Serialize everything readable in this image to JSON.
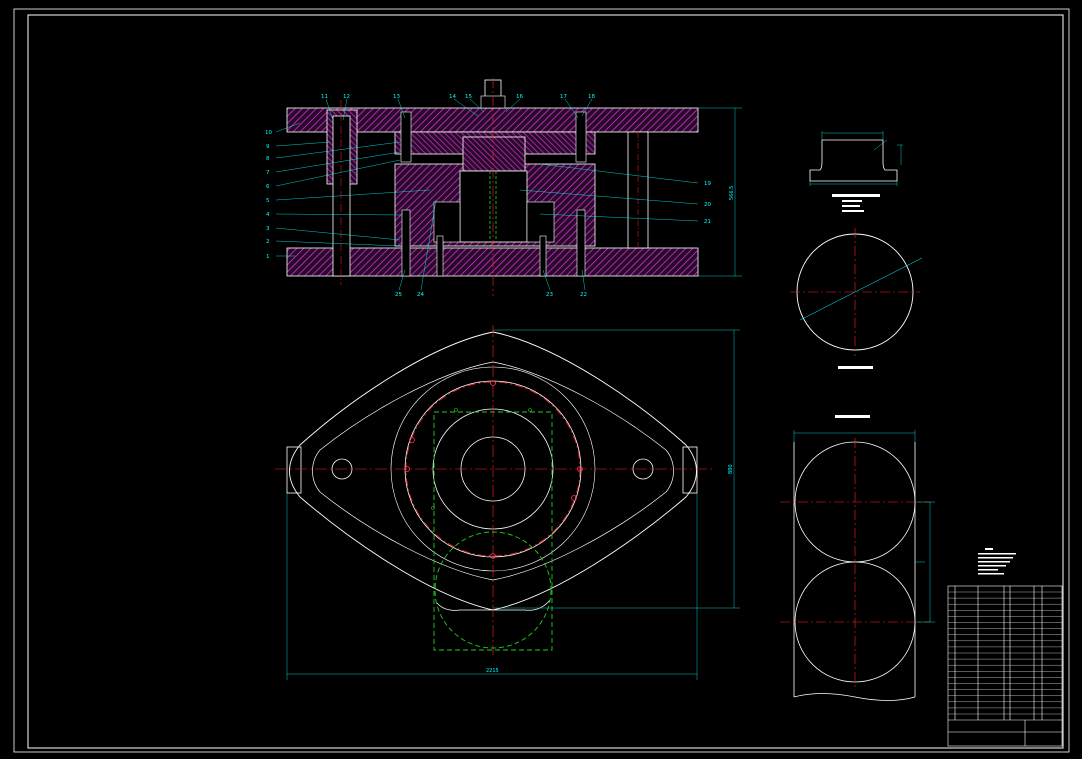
{
  "drawing": {
    "colors": {
      "background": "#000000",
      "outline": "#ffffff",
      "section_fill": "#cc33cc",
      "dimension": "#00ffff",
      "centerline": "#ff2222",
      "blank_outline": "#22cc22",
      "frame": "#ffffff"
    },
    "section_view": {
      "balloons_left": [
        "10",
        "9",
        "8",
        "7",
        "6",
        "5",
        "4",
        "3",
        "2",
        "1"
      ],
      "balloons_top": [
        "11",
        "12",
        "13",
        "14",
        "15",
        "16",
        "17",
        "18"
      ],
      "balloons_right": [
        "19",
        "20",
        "21"
      ],
      "balloons_bottom": [
        "25",
        "24",
        "23",
        "22"
      ],
      "height_dim": "566.5"
    },
    "plan_view": {
      "width_dim": "2215",
      "height_dim": "880"
    }
  }
}
